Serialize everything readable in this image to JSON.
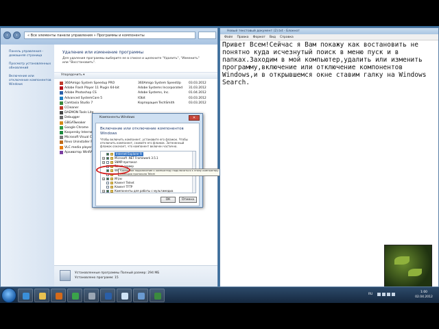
{
  "control_panel": {
    "breadcrumb": "« Все элементы панели управления » Программы и компоненты",
    "sidebar": [
      "Панель управления - домашняя страница",
      "Просмотр установленных обновлений",
      "Включение или отключение компонентов Windows"
    ],
    "heading": "Удаление или изменение программы",
    "description": "Для удаления программы выберите ее в списке и щелкните \"Удалить\", \"Изменить\" или \"Восстановить\".",
    "toolbar_label": "Упорядочить ▾",
    "programs": [
      {
        "name": "360Amigo System Speedup PRO",
        "publisher": "360Amigo System SpeedUp",
        "date": "03.03.2012",
        "icon_color": "#c0392b"
      },
      {
        "name": "Adobe Flash Player 11 Plugin 64-bit",
        "publisher": "Adobe Systems Incorporated",
        "date": "31.03.2012",
        "icon_color": "#b5121b"
      },
      {
        "name": "Adobe Photoshop CS",
        "publisher": "Adobe Systems, Inc.",
        "date": "01.04.2012",
        "icon_color": "#2a5fa8"
      },
      {
        "name": "Advanced SystemCare 5",
        "publisher": "IObit",
        "date": "03.03.2012",
        "icon_color": "#1f7ec2"
      },
      {
        "name": "Camtasia Studio 7",
        "publisher": "Корпорация TechSmith",
        "date": "03.03.2012",
        "icon_color": "#3b8a3e"
      },
      {
        "name": "CCleaner",
        "publisher": "",
        "date": "",
        "icon_color": "#c0392b"
      },
      {
        "name": "DAEMON Tools Lite",
        "publisher": "",
        "date": "",
        "icon_color": "#444444"
      },
      {
        "name": "Debugger",
        "publisher": "",
        "date": "",
        "icon_color": "#6a6a6a"
      },
      {
        "name": "GBGATweaker",
        "publisher": "",
        "date": "",
        "icon_color": "#d48a1a"
      },
      {
        "name": "Google Chrome",
        "publisher": "",
        "date": "",
        "icon_color": "#2e9b43"
      },
      {
        "name": "Kaspersky Internet S",
        "publisher": "",
        "date": "",
        "icon_color": "#1c8a3f"
      },
      {
        "name": "Microsoft Visual C++",
        "publisher": "",
        "date": "",
        "icon_color": "#7a7a7a"
      },
      {
        "name": "Revo Uninstaller Pro",
        "publisher": "",
        "date": "",
        "icon_color": "#c06a1a"
      },
      {
        "name": "VLC media player 2",
        "publisher": "",
        "date": "",
        "icon_color": "#e87b10"
      },
      {
        "name": "Архиватор WinRAR",
        "publisher": "",
        "date": "",
        "icon_color": "#7b3fa0"
      }
    ],
    "status_line1": "Установленные программы  Полный размер: 294 МБ",
    "status_line2": "Установлено программ: 15"
  },
  "dialog": {
    "title": "Компоненты Windows",
    "heading": "Включение или отключение компонентов Windows",
    "text": "Чтобы включить компонент, установите его флажок. Чтобы отключить компонент, снимите его флажок. Затененный флажок означает, что компонент включен частично.",
    "items": [
      {
        "label": "Internet Explorer 9",
        "checked": true,
        "expand": false,
        "selected": true
      },
      {
        "label": "Microsoft .NET Framework 3.5.1",
        "checked": true,
        "expand": true,
        "selected": false
      },
      {
        "label": "SNMP-протокол",
        "checked": false,
        "expand": true,
        "selected": false
      },
      {
        "label": "Telnet-сервер",
        "checked": false,
        "expand": false,
        "selected": false
      },
      {
        "label": "Windows Search",
        "checked": true,
        "expand": false,
        "selected": false
      },
      {
        "label": "",
        "checked": false,
        "expand": false,
        "selected": false
      },
      {
        "label": "Игры",
        "checked": true,
        "expand": true,
        "selected": false
      },
      {
        "label": "Клиент Telnet",
        "checked": false,
        "expand": false,
        "selected": false
      },
      {
        "label": "Клиент TFTP",
        "checked": false,
        "expand": false,
        "selected": false
      },
      {
        "label": "Компоненты для работы с мультимедиа",
        "checked": true,
        "expand": true,
        "selected": false
      }
    ],
    "tooltip": "Удаленное подключение к компьютеру подключаться к этому компьютеру с помощью протокола Telnet",
    "ok": "ОК",
    "cancel": "Отмена"
  },
  "notepad": {
    "title": "Новый текстовый документ (2).txt - Блокнот",
    "menu": [
      "Файл",
      "Правка",
      "Формат",
      "Вид",
      "Справка"
    ],
    "text": "Привет Всем!Сейчас я Вам покажу как востановить не понятно куда исчезнутый поиск в меню пуск и в папках.Заходим в мой компьютер,удалить или изменить программу,включение или отключение компонентов Windows,и в открывшемся окне ставим галку на Windows Search."
  },
  "taskbar": {
    "apps": [
      {
        "name": "ie-icon",
        "color": "#3a8fd8"
      },
      {
        "name": "folder-icon",
        "color": "#e8c050"
      },
      {
        "name": "media-icon",
        "color": "#d46a1a"
      },
      {
        "name": "chrome-icon",
        "color": "#3aa34a"
      },
      {
        "name": "tools-icon",
        "color": "#9aa6b4"
      },
      {
        "name": "photoshop-icon",
        "color": "#2a5fa8"
      },
      {
        "name": "notepad-icon",
        "color": "#cfe3f5"
      },
      {
        "name": "control-panel-icon",
        "color": "#6a9ad0"
      },
      {
        "name": "camtasia-icon",
        "color": "#3b8a3e"
      }
    ],
    "lang": "RU",
    "time": "1:00",
    "date": "02.04.2012"
  }
}
